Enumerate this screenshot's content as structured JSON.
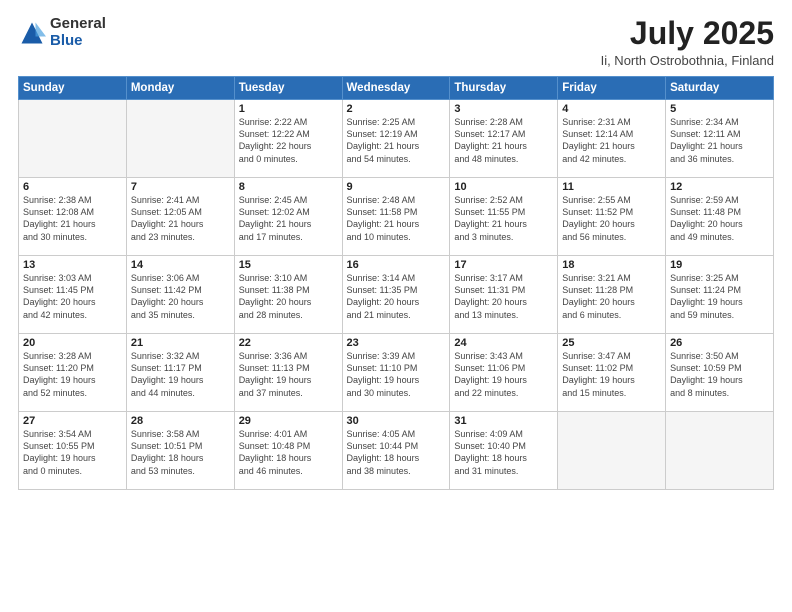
{
  "logo": {
    "general": "General",
    "blue": "Blue"
  },
  "title": "July 2025",
  "subtitle": "Ii, North Ostrobothnia, Finland",
  "headers": [
    "Sunday",
    "Monday",
    "Tuesday",
    "Wednesday",
    "Thursday",
    "Friday",
    "Saturday"
  ],
  "weeks": [
    [
      {
        "day": "",
        "info": ""
      },
      {
        "day": "",
        "info": ""
      },
      {
        "day": "1",
        "info": "Sunrise: 2:22 AM\nSunset: 12:22 AM\nDaylight: 22 hours\nand 0 minutes."
      },
      {
        "day": "2",
        "info": "Sunrise: 2:25 AM\nSunset: 12:19 AM\nDaylight: 21 hours\nand 54 minutes."
      },
      {
        "day": "3",
        "info": "Sunrise: 2:28 AM\nSunset: 12:17 AM\nDaylight: 21 hours\nand 48 minutes."
      },
      {
        "day": "4",
        "info": "Sunrise: 2:31 AM\nSunset: 12:14 AM\nDaylight: 21 hours\nand 42 minutes."
      },
      {
        "day": "5",
        "info": "Sunrise: 2:34 AM\nSunset: 12:11 AM\nDaylight: 21 hours\nand 36 minutes."
      }
    ],
    [
      {
        "day": "6",
        "info": "Sunrise: 2:38 AM\nSunset: 12:08 AM\nDaylight: 21 hours\nand 30 minutes."
      },
      {
        "day": "7",
        "info": "Sunrise: 2:41 AM\nSunset: 12:05 AM\nDaylight: 21 hours\nand 23 minutes."
      },
      {
        "day": "8",
        "info": "Sunrise: 2:45 AM\nSunset: 12:02 AM\nDaylight: 21 hours\nand 17 minutes."
      },
      {
        "day": "9",
        "info": "Sunrise: 2:48 AM\nSunset: 11:58 PM\nDaylight: 21 hours\nand 10 minutes."
      },
      {
        "day": "10",
        "info": "Sunrise: 2:52 AM\nSunset: 11:55 PM\nDaylight: 21 hours\nand 3 minutes."
      },
      {
        "day": "11",
        "info": "Sunrise: 2:55 AM\nSunset: 11:52 PM\nDaylight: 20 hours\nand 56 minutes."
      },
      {
        "day": "12",
        "info": "Sunrise: 2:59 AM\nSunset: 11:48 PM\nDaylight: 20 hours\nand 49 minutes."
      }
    ],
    [
      {
        "day": "13",
        "info": "Sunrise: 3:03 AM\nSunset: 11:45 PM\nDaylight: 20 hours\nand 42 minutes."
      },
      {
        "day": "14",
        "info": "Sunrise: 3:06 AM\nSunset: 11:42 PM\nDaylight: 20 hours\nand 35 minutes."
      },
      {
        "day": "15",
        "info": "Sunrise: 3:10 AM\nSunset: 11:38 PM\nDaylight: 20 hours\nand 28 minutes."
      },
      {
        "day": "16",
        "info": "Sunrise: 3:14 AM\nSunset: 11:35 PM\nDaylight: 20 hours\nand 21 minutes."
      },
      {
        "day": "17",
        "info": "Sunrise: 3:17 AM\nSunset: 11:31 PM\nDaylight: 20 hours\nand 13 minutes."
      },
      {
        "day": "18",
        "info": "Sunrise: 3:21 AM\nSunset: 11:28 PM\nDaylight: 20 hours\nand 6 minutes."
      },
      {
        "day": "19",
        "info": "Sunrise: 3:25 AM\nSunset: 11:24 PM\nDaylight: 19 hours\nand 59 minutes."
      }
    ],
    [
      {
        "day": "20",
        "info": "Sunrise: 3:28 AM\nSunset: 11:20 PM\nDaylight: 19 hours\nand 52 minutes."
      },
      {
        "day": "21",
        "info": "Sunrise: 3:32 AM\nSunset: 11:17 PM\nDaylight: 19 hours\nand 44 minutes."
      },
      {
        "day": "22",
        "info": "Sunrise: 3:36 AM\nSunset: 11:13 PM\nDaylight: 19 hours\nand 37 minutes."
      },
      {
        "day": "23",
        "info": "Sunrise: 3:39 AM\nSunset: 11:10 PM\nDaylight: 19 hours\nand 30 minutes."
      },
      {
        "day": "24",
        "info": "Sunrise: 3:43 AM\nSunset: 11:06 PM\nDaylight: 19 hours\nand 22 minutes."
      },
      {
        "day": "25",
        "info": "Sunrise: 3:47 AM\nSunset: 11:02 PM\nDaylight: 19 hours\nand 15 minutes."
      },
      {
        "day": "26",
        "info": "Sunrise: 3:50 AM\nSunset: 10:59 PM\nDaylight: 19 hours\nand 8 minutes."
      }
    ],
    [
      {
        "day": "27",
        "info": "Sunrise: 3:54 AM\nSunset: 10:55 PM\nDaylight: 19 hours\nand 0 minutes."
      },
      {
        "day": "28",
        "info": "Sunrise: 3:58 AM\nSunset: 10:51 PM\nDaylight: 18 hours\nand 53 minutes."
      },
      {
        "day": "29",
        "info": "Sunrise: 4:01 AM\nSunset: 10:48 PM\nDaylight: 18 hours\nand 46 minutes."
      },
      {
        "day": "30",
        "info": "Sunrise: 4:05 AM\nSunset: 10:44 PM\nDaylight: 18 hours\nand 38 minutes."
      },
      {
        "day": "31",
        "info": "Sunrise: 4:09 AM\nSunset: 10:40 PM\nDaylight: 18 hours\nand 31 minutes."
      },
      {
        "day": "",
        "info": ""
      },
      {
        "day": "",
        "info": ""
      }
    ]
  ]
}
